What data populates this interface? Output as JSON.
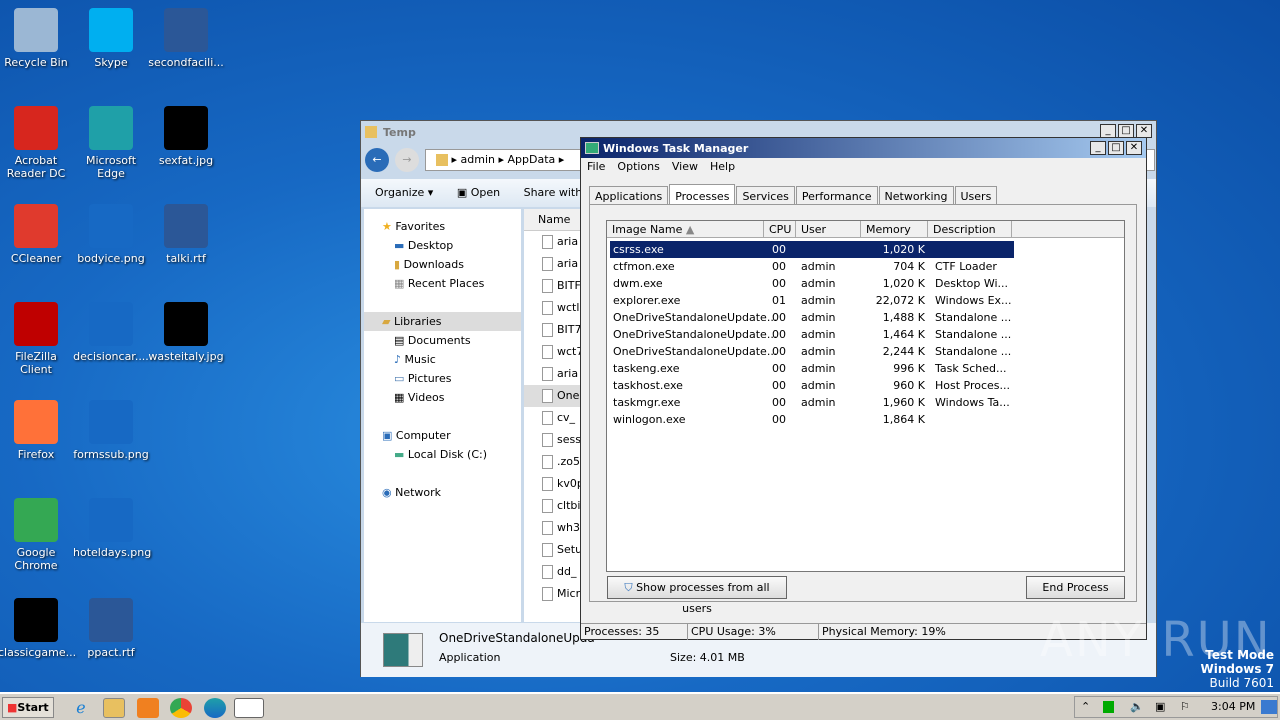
{
  "desktop": {
    "icons": [
      {
        "label": "Recycle Bin",
        "color": "#9bb7d4"
      },
      {
        "label": "Skype",
        "color": "#00aff0"
      },
      {
        "label": "secondfacili...",
        "color": "#2b5797"
      },
      {
        "label": "Acrobat Reader DC",
        "color": "#d7261e"
      },
      {
        "label": "Microsoft Edge",
        "color": "#1fa0a8"
      },
      {
        "label": "sexfat.jpg",
        "color": "#000000"
      },
      {
        "label": "CCleaner",
        "color": "#e03a2d"
      },
      {
        "label": "bodyice.png",
        "color": "#1769c4"
      },
      {
        "label": "talki.rtf",
        "color": "#2b5797"
      },
      {
        "label": "FileZilla Client",
        "color": "#bf0000"
      },
      {
        "label": "decisioncar....",
        "color": "#1769c4"
      },
      {
        "label": "wasteitaly.jpg",
        "color": "#000000"
      },
      {
        "label": "Firefox",
        "color": "#ff7139"
      },
      {
        "label": "formssub.png",
        "color": "#1769c4"
      },
      {
        "label": "Google Chrome",
        "color": "#34a853"
      },
      {
        "label": "hoteldays.png",
        "color": "#1769c4"
      },
      {
        "label": "classicgame...",
        "color": "#000000"
      },
      {
        "label": "ppact.rtf",
        "color": "#2b5797"
      }
    ]
  },
  "explorer": {
    "title": "Temp",
    "breadcrumb": [
      "admin",
      "AppData"
    ],
    "toolbar": {
      "organize": "Organize",
      "open": "Open",
      "share": "Share with"
    },
    "nav": {
      "favorites": "Favorites",
      "desktop": "Desktop",
      "downloads": "Downloads",
      "recent": "Recent Places",
      "libraries": "Libraries",
      "documents": "Documents",
      "music": "Music",
      "pictures": "Pictures",
      "videos": "Videos",
      "computer": "Computer",
      "localdisk": "Local Disk (C:)",
      "network": "Network"
    },
    "column_name": "Name",
    "files": [
      "aria",
      "aria",
      "BITF",
      "wctl",
      "BIT7",
      "wct7",
      "aria",
      "One",
      "cv_",
      "sess",
      ".zo5",
      "kv0p",
      "cltbi",
      "wh3",
      "Setu",
      "dd_",
      "Micr"
    ],
    "details": {
      "name": "OneDriveStandaloneUpda",
      "type": "Application",
      "size": "Size: 4.01 MB"
    }
  },
  "taskmanager": {
    "title": "Windows Task Manager",
    "menu": [
      "File",
      "Options",
      "View",
      "Help"
    ],
    "tabs": [
      "Applications",
      "Processes",
      "Services",
      "Performance",
      "Networking",
      "Users"
    ],
    "columns": [
      "Image Name",
      "CPU",
      "User Name",
      "Memory (...",
      "Description"
    ],
    "processes": [
      {
        "name": "csrss.exe",
        "cpu": "00",
        "user": "",
        "mem": "1,020 K",
        "desc": ""
      },
      {
        "name": "ctfmon.exe",
        "cpu": "00",
        "user": "admin",
        "mem": "704 K",
        "desc": "CTF Loader"
      },
      {
        "name": "dwm.exe",
        "cpu": "00",
        "user": "admin",
        "mem": "1,020 K",
        "desc": "Desktop Wi..."
      },
      {
        "name": "explorer.exe",
        "cpu": "01",
        "user": "admin",
        "mem": "22,072 K",
        "desc": "Windows Ex..."
      },
      {
        "name": "OneDriveStandaloneUpdate...",
        "cpu": "00",
        "user": "admin",
        "mem": "1,488 K",
        "desc": "Standalone ..."
      },
      {
        "name": "OneDriveStandaloneUpdate...",
        "cpu": "00",
        "user": "admin",
        "mem": "1,464 K",
        "desc": "Standalone ..."
      },
      {
        "name": "OneDriveStandaloneUpdate...",
        "cpu": "00",
        "user": "admin",
        "mem": "2,244 K",
        "desc": "Standalone ..."
      },
      {
        "name": "taskeng.exe",
        "cpu": "00",
        "user": "admin",
        "mem": "996 K",
        "desc": "Task Sched..."
      },
      {
        "name": "taskhost.exe",
        "cpu": "00",
        "user": "admin",
        "mem": "960 K",
        "desc": "Host Proces..."
      },
      {
        "name": "taskmgr.exe",
        "cpu": "00",
        "user": "admin",
        "mem": "1,960 K",
        "desc": "Windows Ta..."
      },
      {
        "name": "winlogon.exe",
        "cpu": "00",
        "user": "",
        "mem": "1,864 K",
        "desc": ""
      }
    ],
    "show_all": "Show processes from all users",
    "end_process": "End Process",
    "status": {
      "processes": "Processes: 35",
      "cpu": "CPU Usage: 3%",
      "memory": "Physical Memory: 19%"
    }
  },
  "watermark": {
    "text": "ANY RUN",
    "mode": "Test Mode",
    "os": "Windows 7",
    "build": "Build 7601"
  },
  "taskbar": {
    "start": "Start",
    "clock": "3:04 PM"
  }
}
